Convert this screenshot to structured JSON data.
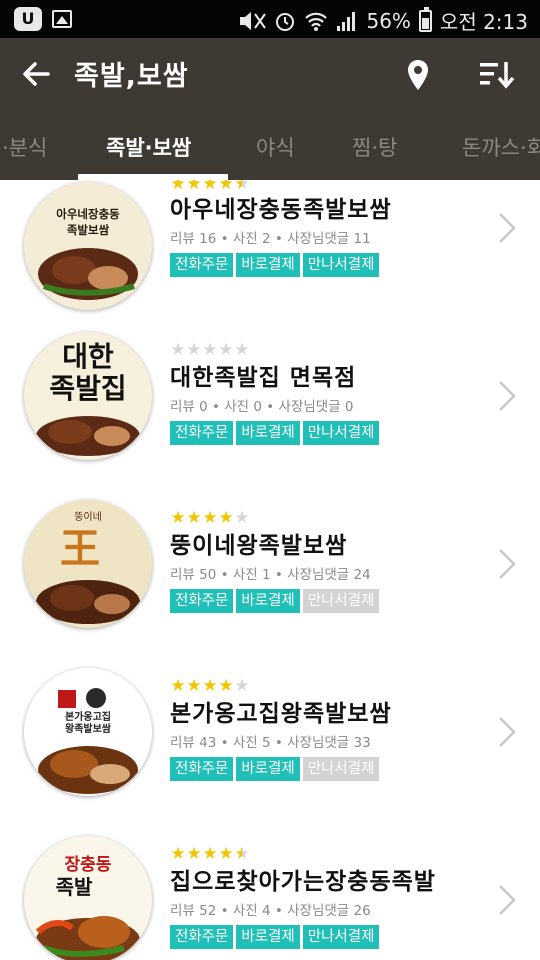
{
  "status_bar": {
    "app_badge": "U",
    "battery": "56%",
    "battery_level": 0.56,
    "time": "오전 2:13"
  },
  "app_bar": {
    "title": "족발,보쌈",
    "back_icon": "arrow-left-icon",
    "location_icon": "map-pin-icon",
    "sort_icon": "sort-icon"
  },
  "tabs": [
    {
      "label": "·분식",
      "active": false
    },
    {
      "label": "족발·보쌈",
      "active": true
    },
    {
      "label": "야식",
      "active": false
    },
    {
      "label": "찜·탕",
      "active": false
    },
    {
      "label": "돈까스·회",
      "active": false
    }
  ],
  "restaurants": [
    {
      "rating": 4.5,
      "thumb_text": [
        "아우네장충동",
        "족발보쌈"
      ],
      "name": "아우네장충동족발보쌈",
      "meta": "리뷰 16  •  사진 2  •  사장님댓글 11",
      "badges": [
        {
          "label": "전화주문",
          "enabled": true
        },
        {
          "label": "바로결제",
          "enabled": true
        },
        {
          "label": "만나서결제",
          "enabled": true
        }
      ]
    },
    {
      "rating": 0,
      "thumb_text": [
        "대한",
        "족발집"
      ],
      "name": "대한족발집 면목점",
      "meta": "리뷰 0  •  사진 0  •  사장님댓글 0",
      "badges": [
        {
          "label": "전화주문",
          "enabled": true
        },
        {
          "label": "바로결제",
          "enabled": true
        },
        {
          "label": "만나서결제",
          "enabled": true
        }
      ]
    },
    {
      "rating": 4,
      "thumb_text": [
        "뚱이네",
        "王"
      ],
      "name": "뚱이네왕족발보쌈",
      "meta": "리뷰 50  •  사진 1  •  사장님댓글 24",
      "badges": [
        {
          "label": "전화주문",
          "enabled": true
        },
        {
          "label": "바로결제",
          "enabled": true
        },
        {
          "label": "만나서결제",
          "enabled": false
        }
      ]
    },
    {
      "rating": 4,
      "thumb_text": [
        "본가옹고집",
        "왕족발보쌈"
      ],
      "name": "본가옹고집왕족발보쌈",
      "meta": "리뷰 43  •  사진 5  •  사장님댓글 33",
      "badges": [
        {
          "label": "전화주문",
          "enabled": true
        },
        {
          "label": "바로결제",
          "enabled": true
        },
        {
          "label": "만나서결제",
          "enabled": false
        }
      ]
    },
    {
      "rating": 4.5,
      "thumb_text": [
        "장충동",
        "족발"
      ],
      "name": "집으로찾아가는장충동족발",
      "meta": "리뷰 52  •  사진 4  •  사장님댓글 26",
      "badges": [
        {
          "label": "전화주문",
          "enabled": true
        },
        {
          "label": "바로결제",
          "enabled": true
        },
        {
          "label": "만나서결제",
          "enabled": true
        }
      ]
    }
  ],
  "colors": {
    "app_bar": "#3e3a33",
    "accent": "#20c0b8",
    "star": "#f5c400",
    "disabled_badge": "#d3d3d3"
  }
}
